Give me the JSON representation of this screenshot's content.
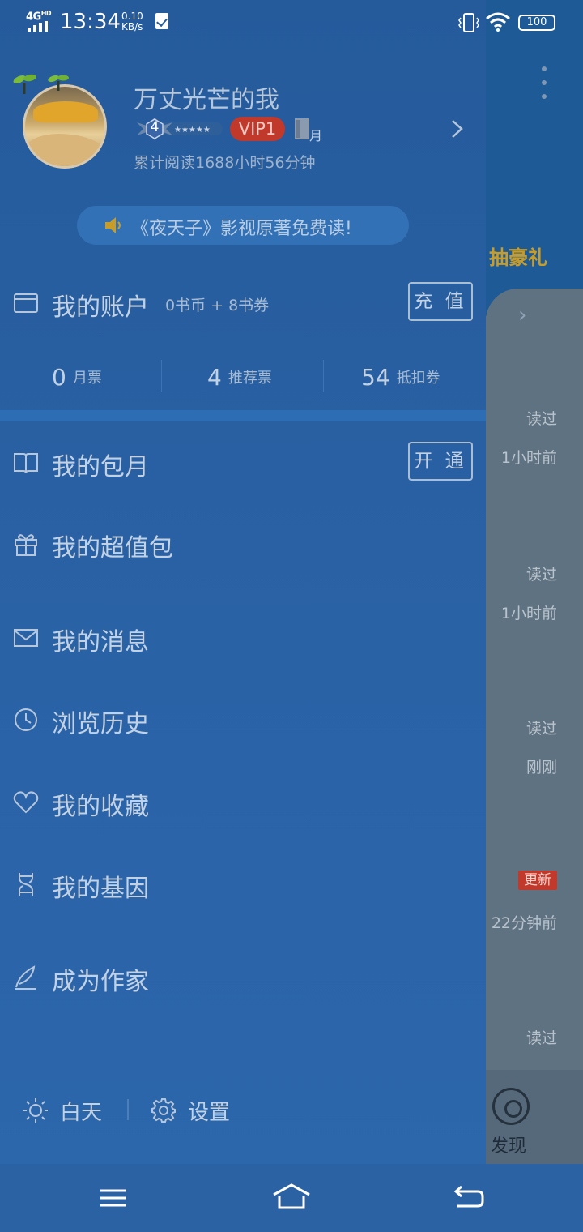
{
  "status_bar": {
    "network": "4G",
    "network_sup": "HD",
    "time": "13:34",
    "speed_value": "0.10",
    "speed_unit": "KB/s",
    "battery": "100"
  },
  "background_app": {
    "promo_label": "抽豪礼",
    "rows": [
      {
        "status": "读过",
        "time": "1小时前"
      },
      {
        "status": "读过",
        "time": "1小时前"
      },
      {
        "status": "读过",
        "time": "刚刚"
      },
      {
        "status": "更新",
        "time": "22分钟前"
      },
      {
        "status": "读过"
      }
    ],
    "discover_label": "发现"
  },
  "profile": {
    "username": "万丈光芒的我",
    "level": "4",
    "vip": "VIP1",
    "month_badge": "月",
    "reading_time": "累计阅读1688小时56分钟"
  },
  "promo": {
    "text": "《夜天子》影视原著免费读!"
  },
  "account": {
    "label": "我的账户",
    "sub": "0书币 + 8书券",
    "recharge": "充 值",
    "stats": [
      {
        "value": "0",
        "unit": "月票"
      },
      {
        "value": "4",
        "unit": "推荐票"
      },
      {
        "value": "54",
        "unit": "抵扣券"
      }
    ]
  },
  "menu": {
    "monthly": "我的包月",
    "monthly_button": "开 通",
    "value_pack": "我的超值包",
    "messages": "我的消息",
    "history": "浏览历史",
    "favorites": "我的收藏",
    "gene": "我的基因",
    "author": "成为作家"
  },
  "footer": {
    "daytime": "白天",
    "settings": "设置"
  },
  "colors": {
    "drawer": "#2a62a6",
    "vip_red": "#c0392b",
    "promo_gold": "#c89c28"
  }
}
